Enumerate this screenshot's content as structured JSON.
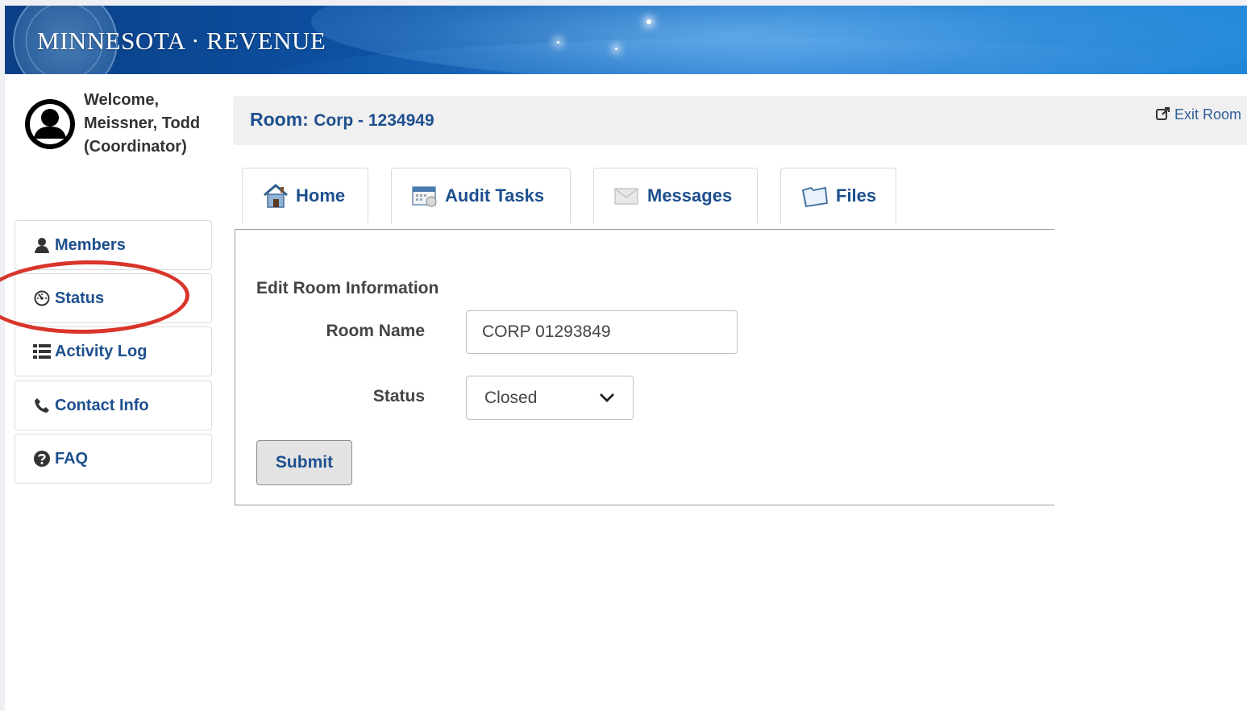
{
  "banner": {
    "title": "MINNESOTA · REVENUE"
  },
  "user": {
    "welcome_line1": "Welcome,",
    "welcome_line2": "Meissner, Todd",
    "welcome_line3": "(Coordinator)"
  },
  "room": {
    "label": "Room:",
    "value": "Corp - 1234949",
    "exit_label": "Exit Room"
  },
  "tabs": [
    {
      "label": "Home",
      "icon": "house-icon"
    },
    {
      "label": "Audit Tasks",
      "icon": "calendar-icon"
    },
    {
      "label": "Messages",
      "icon": "envelope-icon"
    },
    {
      "label": "Files",
      "icon": "folder-icon"
    }
  ],
  "sidebar": {
    "items": [
      {
        "label": "Members",
        "icon": "user-icon"
      },
      {
        "label": "Status",
        "icon": "dashboard-icon"
      },
      {
        "label": "Activity Log",
        "icon": "list-icon"
      },
      {
        "label": "Contact Info",
        "icon": "phone-icon"
      },
      {
        "label": "FAQ",
        "icon": "question-icon"
      }
    ]
  },
  "form": {
    "title": "Edit Room Information",
    "room_name_label": "Room Name",
    "room_name_value": "CORP 01293849",
    "status_label": "Status",
    "status_value": "Closed",
    "submit_label": "Submit"
  },
  "colors": {
    "link": "#1d4f8e",
    "annotation": "#d9352b",
    "banner_dark": "#0b3f86",
    "banner_light": "#1f86d8"
  }
}
